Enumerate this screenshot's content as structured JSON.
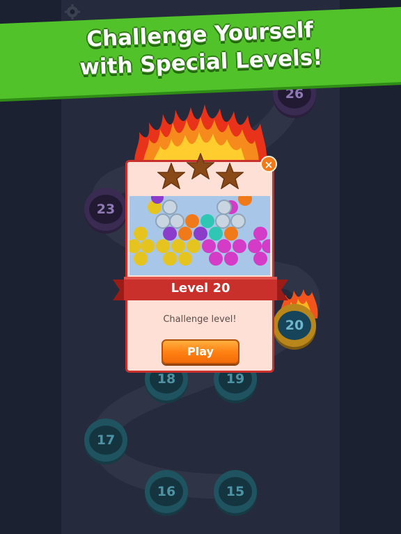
{
  "banner": {
    "line1": "Challenge Yourself",
    "line2": "with Special Levels!",
    "color": "#51c22a"
  },
  "map": {
    "nodes": [
      {
        "label": "26",
        "style": "purple"
      },
      {
        "label": "23",
        "style": "purple"
      },
      {
        "label": "20",
        "style": "gold"
      },
      {
        "label": "18",
        "style": "teal"
      },
      {
        "label": "19",
        "style": "teal"
      },
      {
        "label": "17",
        "style": "teal"
      },
      {
        "label": "16",
        "style": "teal"
      },
      {
        "label": "15",
        "style": "teal"
      }
    ],
    "settings_icon": "gear-icon"
  },
  "popup": {
    "title": "Level 20",
    "description": "Challenge level!",
    "play_label": "Play",
    "close_icon": "close-icon",
    "stars_earned": 0,
    "stars_total": 3,
    "accent": "#c9302c",
    "button_color": "#ff8214"
  }
}
